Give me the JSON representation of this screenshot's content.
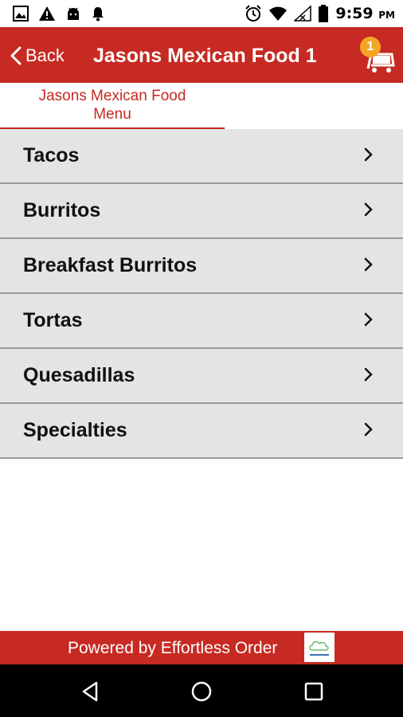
{
  "status_bar": {
    "time": "9:59",
    "ampm": "PM",
    "icons": [
      "image-icon",
      "warning-icon",
      "android-icon",
      "bell-icon",
      "alarm-icon",
      "wifi-icon",
      "signal-icon",
      "battery-icon"
    ]
  },
  "header": {
    "back_label": "Back",
    "title": "Jasons Mexican Food 1",
    "cart_count": "1",
    "color": "#c62a22",
    "badge_color": "#f5a623"
  },
  "tabs": [
    {
      "label": "Jasons Mexican Food Menu"
    }
  ],
  "categories": [
    {
      "label": "Tacos"
    },
    {
      "label": "Burritos"
    },
    {
      "label": "Breakfast Burritos"
    },
    {
      "label": "Tortas"
    },
    {
      "label": "Quesadillas"
    },
    {
      "label": "Specialties"
    }
  ],
  "footer": {
    "powered_by": "Powered by Effortless Order"
  },
  "nav_bar": {
    "buttons": [
      "back-triangle-icon",
      "home-circle-icon",
      "recents-square-icon"
    ]
  }
}
